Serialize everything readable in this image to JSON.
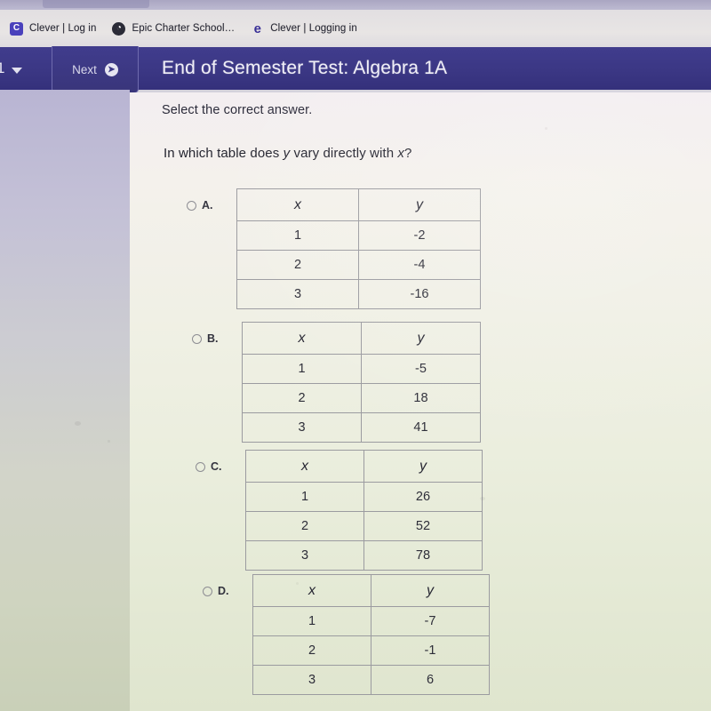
{
  "browser": {
    "tabs": [
      {
        "title": "Clever | Log in",
        "favicon": "clever-icon",
        "glyph": "C"
      },
      {
        "title": "Epic Charter School…",
        "favicon": "epic-globe-icon",
        "glyph": "◔"
      },
      {
        "title": "Clever | Logging in",
        "favicon": "edge-icon",
        "glyph": "e"
      }
    ]
  },
  "appbar": {
    "question_number": "1",
    "question_dropdown_icon": "chevron-down-icon",
    "next_label": "Next",
    "next_icon": "arrow-right-circle-icon",
    "test_title": "End of Semester Test: Algebra 1A",
    "bar_color": "#3b3789"
  },
  "question": {
    "instruction": "Select the correct answer.",
    "text_before": "In which table does ",
    "var_y": "y",
    "text_middle": " vary directly with ",
    "var_x": "x",
    "text_after": "?"
  },
  "options": [
    {
      "letter": "A.",
      "selected": false,
      "table": {
        "headers": [
          "x",
          "y"
        ],
        "rows": [
          [
            "1",
            "-2"
          ],
          [
            "2",
            "-4"
          ],
          [
            "3",
            "-16"
          ]
        ]
      }
    },
    {
      "letter": "B.",
      "selected": false,
      "table": {
        "headers": [
          "x",
          "y"
        ],
        "rows": [
          [
            "1",
            "-5"
          ],
          [
            "2",
            "18"
          ],
          [
            "3",
            "41"
          ]
        ]
      }
    },
    {
      "letter": "C.",
      "selected": false,
      "table": {
        "headers": [
          "x",
          "y"
        ],
        "rows": [
          [
            "1",
            "26"
          ],
          [
            "2",
            "52"
          ],
          [
            "3",
            "78"
          ]
        ]
      }
    },
    {
      "letter": "D.",
      "selected": false,
      "table": {
        "headers": [
          "x",
          "y"
        ],
        "rows": [
          [
            "1",
            "-7"
          ],
          [
            "2",
            "-1"
          ],
          [
            "3",
            "6"
          ]
        ]
      }
    }
  ]
}
